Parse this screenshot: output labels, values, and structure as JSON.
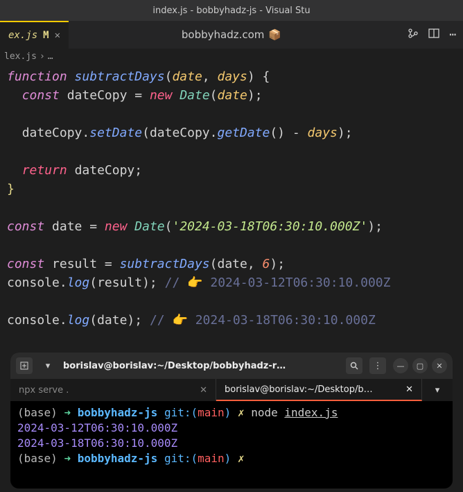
{
  "window": {
    "title": "index.js - bobbyhadz-js - Visual Stu"
  },
  "tab": {
    "name": "ex.js",
    "modified": "M",
    "close": "✕"
  },
  "center": {
    "text": "bobbyhadz.com",
    "emoji": "📦"
  },
  "breadcrumb": {
    "file": "lex.js",
    "sep": "›",
    "rest": "…"
  },
  "code": {
    "l1_func": "function",
    "l1_name": "subtractDays",
    "l1_p1": "date",
    "l1_p2": "days",
    "l2_const": "const",
    "l2_var": "dateCopy",
    "l2_new": "new",
    "l2_type": "Date",
    "l2_arg": "date",
    "l3_obj": "dateCopy",
    "l3_set": "setDate",
    "l3_obj2": "dateCopy",
    "l3_get": "getDate",
    "l3_minus_arg": "days",
    "l4_return": "return",
    "l4_var": "dateCopy",
    "l5_const": "const",
    "l5_var": "date",
    "l5_new": "new",
    "l5_type": "Date",
    "l5_str": "'2024-03-18T06:30:10.000Z'",
    "l6_const": "const",
    "l6_var": "result",
    "l6_fn": "subtractDays",
    "l6_a1": "date",
    "l6_a2": "6",
    "l7_console": "console",
    "l7_log": "log",
    "l7_arg": "result",
    "l7_comment": "// 👉️ 2024-03-12T06:30:10.000Z",
    "l8_console": "console",
    "l8_log": "log",
    "l8_arg": "date",
    "l8_comment": "// 👉️ 2024-03-18T06:30:10.000Z"
  },
  "terminal": {
    "title": "borislav@borislav:~/Desktop/bobbyhadz-r…",
    "tabs": {
      "t1": "npx serve .",
      "t2": "borislav@borislav:~/Desktop/b…",
      "close": "✕",
      "dropdown": "▾"
    },
    "lines": {
      "base": "(base)",
      "arrow": "➜",
      "dir": "bobbyhadz-js",
      "git": "git:(",
      "branch": "main",
      "gitclose": ")",
      "cross": "✗",
      "node": "node",
      "file": "index.js",
      "out1": "2024-03-12T06:30:10.000Z",
      "out2": "2024-03-18T06:30:10.000Z"
    }
  }
}
